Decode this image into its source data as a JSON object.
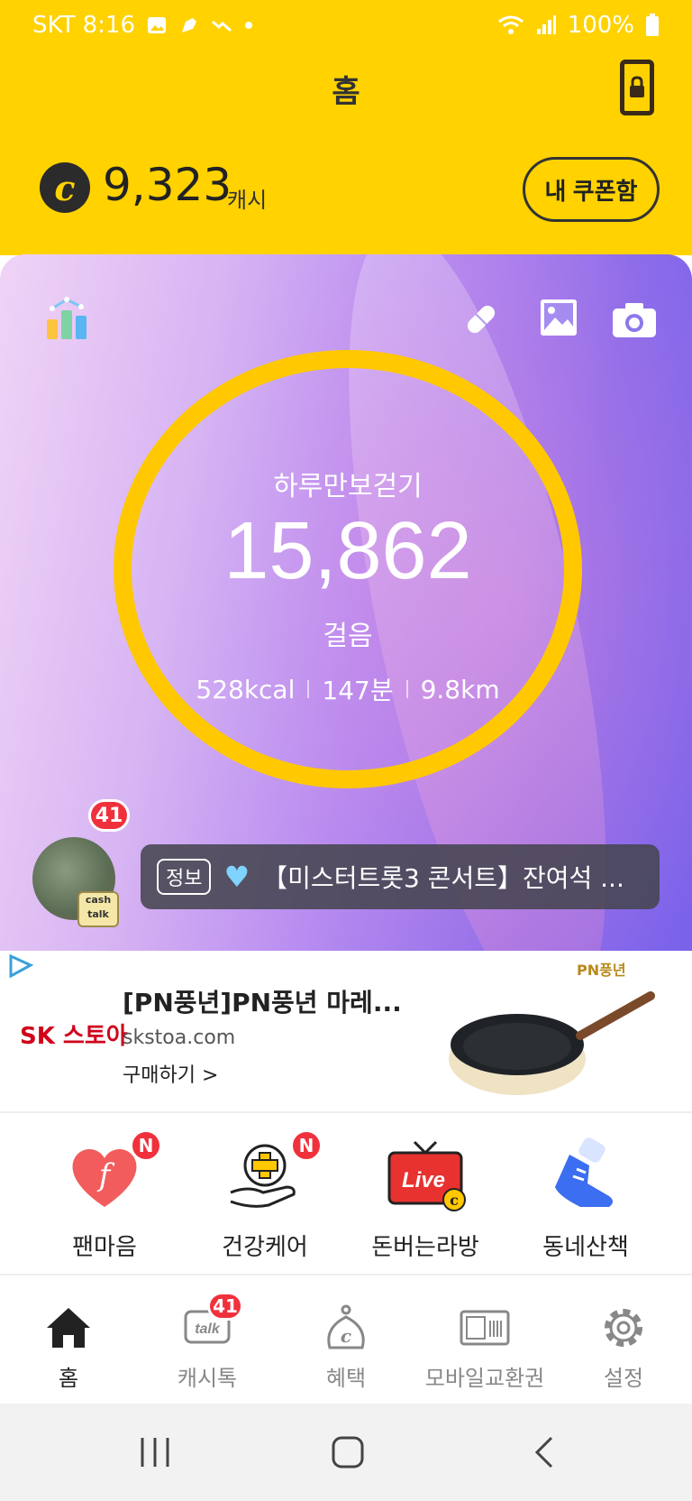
{
  "status_bar": {
    "carrier_time": "SKT 8:16",
    "battery": "100%"
  },
  "header": {
    "title": "홈"
  },
  "cash": {
    "amount": "9,323",
    "unit": "캐시",
    "coupon_button": "내 쿠폰함"
  },
  "walk": {
    "label": "하루만보걷기",
    "steps": "15,862",
    "unit": "걸음",
    "kcal": "528kcal",
    "minutes": "147분",
    "distance": "9.8km"
  },
  "cashtalk": {
    "badge": "41",
    "tag_text": "cash talk",
    "bubble_tag": "정보",
    "bubble_text": "【미스터트롯3 콘서트】잔여석 ..."
  },
  "ad": {
    "advertiser": "SK 스토아",
    "title": "[PN풍년]PN풍년 마레...",
    "url": "skstoa.com",
    "cta": "구매하기 >",
    "brand": "PN풍년"
  },
  "quick_menu": [
    {
      "label": "팬마음",
      "badge": "N"
    },
    {
      "label": "건강케어",
      "badge": "N"
    },
    {
      "label": "돈버는라방",
      "badge": ""
    },
    {
      "label": "동네산책",
      "badge": ""
    }
  ],
  "bottom_nav": {
    "items": [
      {
        "label": "홈",
        "active": true
      },
      {
        "label": "캐시톡",
        "badge": "41"
      },
      {
        "label": "혜택"
      },
      {
        "label": "모바일교환권"
      },
      {
        "label": "설정"
      }
    ]
  },
  "colors": {
    "brand_yellow": "#FFD200",
    "ring_yellow": "#FFC800",
    "badge_red": "#F0313C"
  }
}
